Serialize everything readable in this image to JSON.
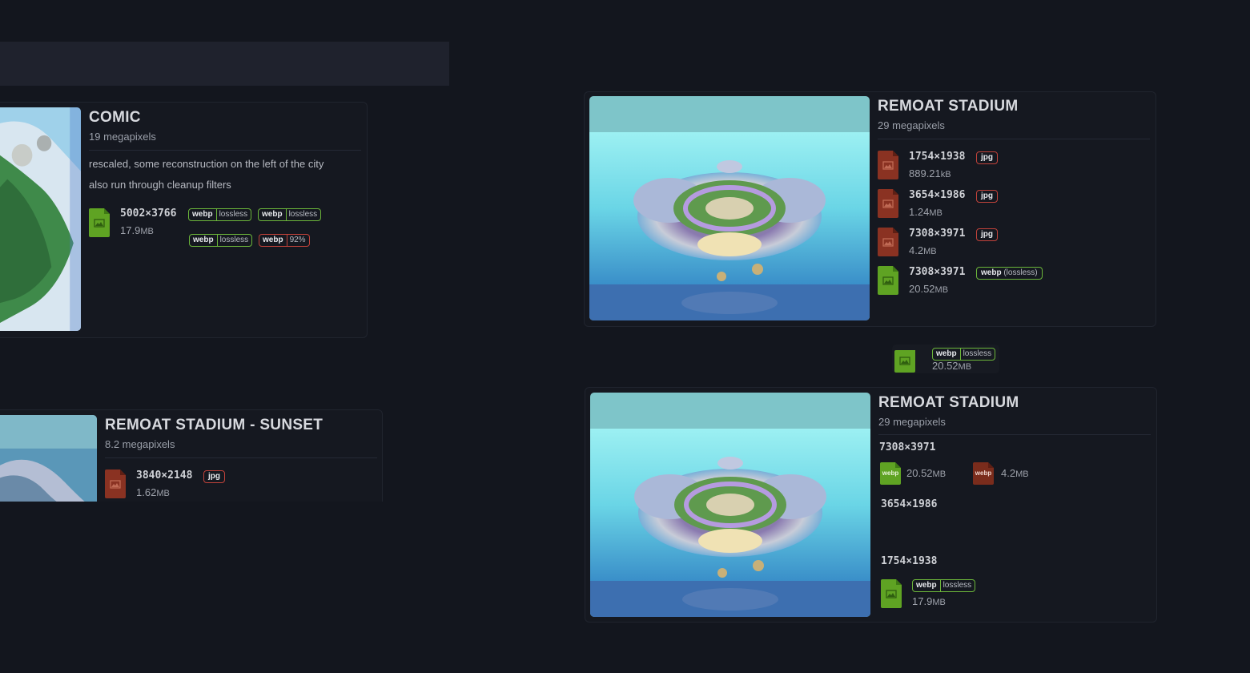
{
  "cards": {
    "comic": {
      "title": "COMIC",
      "megapixels": "19 megapixels",
      "desc1": "rescaled, some reconstruction on the left of the city",
      "desc2": "also run through cleanup filters",
      "file": {
        "res": "5002×3766",
        "size": "17.9",
        "unit": "MB",
        "icon": "image-file-icon-green"
      },
      "variants": [
        {
          "format": "webp",
          "quality": "lossless"
        },
        {
          "format": "webp",
          "quality": "lossless"
        },
        {
          "format": "webp",
          "quality": "lossless"
        },
        {
          "format": "webp",
          "quality": "92%"
        }
      ]
    },
    "sunset": {
      "title": "REMOAT STADIUM - SUNSET",
      "megapixels": "8.2 megapixels",
      "file": {
        "res": "3840×2148",
        "format": "jpg",
        "size": "1.62",
        "unit": "MB",
        "icon": "image-file-icon-red"
      }
    },
    "stadium1": {
      "title": "REMOAT STADIUM",
      "megapixels": "29 megapixels",
      "files": [
        {
          "res": "1754×1938",
          "format": "jpg",
          "size": "889.21",
          "unit": "kB",
          "icon": "image-file-icon-red"
        },
        {
          "res": "3654×1986",
          "format": "jpg",
          "size": "1.24",
          "unit": "MB",
          "icon": "image-file-icon-red"
        },
        {
          "res": "7308×3971",
          "format": "jpg",
          "size": "4.2",
          "unit": "MB",
          "icon": "image-file-icon-red"
        },
        {
          "res": "7308×3971",
          "format": "webp",
          "quality": "(lossless)",
          "size": "20.52",
          "unit": "MB",
          "icon": "image-file-icon-green"
        }
      ]
    },
    "floating": {
      "format": "webp",
      "quality": "lossless",
      "size": "20.52",
      "unit": "MB"
    },
    "stadium2": {
      "title": "REMOAT STADIUM",
      "megapixels": "29 megapixels",
      "res_a": "7308×3971",
      "webp_label": "webp",
      "webp_size": "20.52",
      "webp_unit": "MB",
      "jpg_label": "webp",
      "jpg_size": "4.2",
      "jpg_unit": "MB",
      "res_b": "3654×1986",
      "res_c": "1754×1938",
      "c_format": "webp",
      "c_quality": "lossless",
      "c_size": "17.9",
      "c_unit": "MB"
    }
  },
  "colors": {
    "green": "#5fa323",
    "red": "#8a3222",
    "bg": "#13161e"
  }
}
